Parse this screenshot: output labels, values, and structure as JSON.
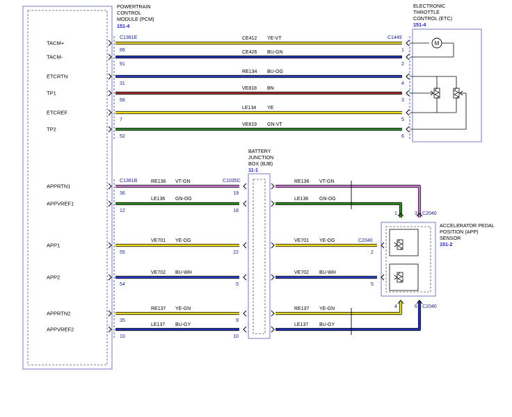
{
  "modules": {
    "pcm": {
      "lines": [
        "POWERTRAIN",
        "CONTROL",
        "MODULE (PCM)"
      ],
      "ref": "151-4"
    },
    "etc": {
      "lines": [
        "ELECTRONIC",
        "THROTTLE",
        "CONTROL (ETC)"
      ],
      "ref": "151-4"
    },
    "bjb": {
      "lines": [
        "BATTERY",
        "JUNCTION",
        "BOX (BJB)"
      ],
      "ref": "11-1"
    },
    "app": {
      "lines": [
        "ACCELERATOR PEDAL",
        "POSITION (APP)",
        "SENSOR"
      ],
      "ref": "151-2"
    }
  },
  "connectors": {
    "pcm_top": "C1381E",
    "etc": "C1449",
    "pcm_bottom": "C1381B",
    "bjb": "C1035C",
    "app_mid": "C2040",
    "app_top": "C2040",
    "app_bottom": "C2040"
  },
  "colors": {
    "YE-VT": "#e8d82a",
    "BU-GN": "#1f2fb0",
    "BU-OG": "#2a3cc0",
    "BN": "#a32a2a",
    "YE": "#f2e21a",
    "GN-VT": "#2f8a2f",
    "VT-GN": "#c878d0",
    "GN-OG": "#2a8a1a",
    "YE-OG": "#f0dc1a",
    "BU-WH": "#2a3cc0",
    "YE-GN": "#e4da20",
    "BU-GY": "#1f2fb0",
    "frame": "#8a90c8",
    "label": "#000000",
    "pin": "#1a1a8c",
    "ref": "#1a1ac8"
  },
  "etc_circuits": [
    {
      "signal": "TACM+",
      "circuit": "CE412",
      "color": "YE-VT",
      "pcm_pin": "86",
      "etc_pin": "1"
    },
    {
      "signal": "TACM-",
      "circuit": "CE426",
      "color": "BU-GN",
      "pcm_pin": "91",
      "etc_pin": "2"
    },
    {
      "signal": "ETCRTN",
      "circuit": "RE134",
      "color": "BU-OG",
      "pcm_pin": "31",
      "etc_pin": "4"
    },
    {
      "signal": "TP1",
      "circuit": "VE818",
      "color": "BN",
      "pcm_pin": "68",
      "etc_pin": "3"
    },
    {
      "signal": "ETCREF",
      "circuit": "LE134",
      "color": "YE",
      "pcm_pin": "7",
      "etc_pin": "5"
    },
    {
      "signal": "TP2",
      "circuit": "VE819",
      "color": "GN-VT",
      "pcm_pin": "52",
      "etc_pin": "6"
    }
  ],
  "app_circuits": [
    {
      "signal": "APPRTN1",
      "circuit": "RE136",
      "color": "VT-GN",
      "pcm_pin": "36",
      "bjb_pin": "19",
      "app_pin": "3"
    },
    {
      "signal": "APPVREF1",
      "circuit": "LE136",
      "color": "GN-OG",
      "pcm_pin": "12",
      "bjb_pin": "18",
      "app_pin": "1"
    },
    {
      "signal": "APP1",
      "circuit": "VE701",
      "color": "YE-OG",
      "pcm_pin": "55",
      "bjb_pin": "22",
      "app_pin": "2"
    },
    {
      "signal": "APP2",
      "circuit": "VE702",
      "color": "BU-WH",
      "pcm_pin": "54",
      "bjb_pin": "5",
      "app_pin": "5"
    },
    {
      "signal": "APPRTN2",
      "circuit": "RE137",
      "color": "YE-GN",
      "pcm_pin": "35",
      "bjb_pin": "9",
      "app_pin": "4"
    },
    {
      "signal": "APPVREF2",
      "circuit": "LE137",
      "color": "BU-GY",
      "pcm_pin": "10",
      "bjb_pin": "10",
      "app_pin": "6"
    }
  ]
}
